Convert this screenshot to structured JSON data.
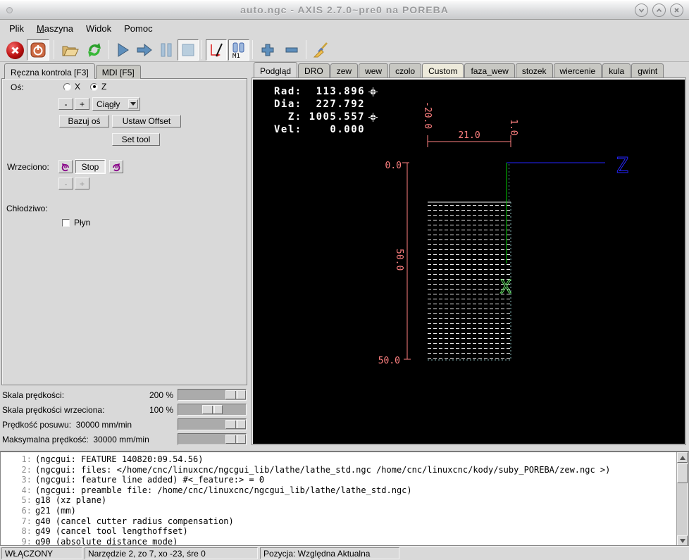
{
  "window": {
    "title": "auto.ngc - AXIS 2.7.0~pre0 na POREBA"
  },
  "menubar": {
    "items": [
      {
        "label": "Plik"
      },
      {
        "label": "Maszyna",
        "mnemonic": true
      },
      {
        "label": "Widok"
      },
      {
        "label": "Pomoc"
      }
    ]
  },
  "toolbar": {
    "m1_label": "M1",
    "button_names": [
      "emergency-stop",
      "machine-power",
      "open-file",
      "reload-file",
      "run-program",
      "step-line",
      "pause-program",
      "stop-program",
      "toggle-toolpath-display",
      "toggle-optional-stop",
      "zoom-in",
      "zoom-out",
      "clear-plot"
    ]
  },
  "left_panel": {
    "tab_active": "Ręczna kontrola [F3]",
    "tab_inactive": "MDI [F5]",
    "axis_label": "Oś:",
    "axis_options": [
      {
        "label": "X",
        "selected": false
      },
      {
        "label": "Z",
        "selected": true
      }
    ],
    "jog_minus": "-",
    "jog_plus": "+",
    "jog_mode": "Ciągły",
    "home_axis": "Bazuj oś",
    "set_offset": "Ustaw Offset",
    "set_tool": "Set tool",
    "spindle_label": "Wrzeciono:",
    "spindle_stop": "Stop",
    "spindle_minus": "-",
    "spindle_plus": "+",
    "coolant_label": "Chłodziwo:",
    "coolant_option": "Płyn"
  },
  "sliders": [
    {
      "label": "Skala prędkości:",
      "value": "200 %",
      "pos": 1
    },
    {
      "label": "Skala prędkości wrzeciona:",
      "value": "100 %",
      "pos": 0.5
    },
    {
      "label": "Prędkość posuwu:  30000 mm/min",
      "value": "",
      "pos": 1
    },
    {
      "label": "Maksymalna prędkość:  30000 mm/min",
      "value": "",
      "pos": 1
    }
  ],
  "preview": {
    "tab_active": "Podgląd",
    "tabs": [
      {
        "label": "DRO"
      },
      {
        "label": "zew"
      },
      {
        "label": "wew"
      },
      {
        "label": "czolo"
      },
      {
        "label": "Custom",
        "tint": "cream"
      },
      {
        "label": "faza_wew"
      },
      {
        "label": "stozek"
      },
      {
        "label": "wiercenie"
      },
      {
        "label": "kula"
      },
      {
        "label": "gwint"
      }
    ],
    "dro": {
      "rad": "Rad:  113.896",
      "dia": "Dia:  227.792",
      "z": "  Z: 1005.557",
      "vel": "Vel:    0.000"
    },
    "dimensions": {
      "width_label": "21.0",
      "left_extent": "-20.0",
      "right_extent": "1.0",
      "origin": "0.0",
      "height_label": "50.0",
      "bottom_extent": "50.0"
    },
    "axis_letters": {
      "z": "Z",
      "x": "X"
    },
    "colors": {
      "dimension": "#ff8080",
      "traverse_blue": "#2525ff",
      "feed_green": "#00cc00",
      "axis_x_green": "#63dd63",
      "feed_white": "#efefef"
    }
  },
  "gcode": {
    "lines": [
      {
        "n": "1:",
        "text": "(ngcgui: FEATURE 140820:09.54.56)"
      },
      {
        "n": "2:",
        "text": "(ngcgui: files: </home/cnc/linuxcnc/ngcgui_lib/lathe/lathe_std.ngc /home/cnc/linuxcnc/kody/suby_POREBA/zew.ngc >)"
      },
      {
        "n": "3:",
        "text": "(ngcgui: feature line added) #<_feature:> = 0"
      },
      {
        "n": "4:",
        "text": "(ngcgui: preamble file: /home/cnc/linuxcnc/ngcgui_lib/lathe/lathe_std.ngc)"
      },
      {
        "n": "5:",
        "text": "g18 (xz plane)"
      },
      {
        "n": "6:",
        "text": "g21 (mm)"
      },
      {
        "n": "7:",
        "text": "g40 (cancel cutter radius compensation)"
      },
      {
        "n": "8:",
        "text": "g49 (cancel tool lengthoffset)"
      },
      {
        "n": "9:",
        "text": "g90 (absolute distance mode)"
      }
    ]
  },
  "statusbar": {
    "machine_state": "WŁĄCZONY",
    "tool_info": "Narzędzie 2, zo 7, xo -23, śre 0",
    "position_mode": "Pozycja: Względna Aktualna"
  }
}
